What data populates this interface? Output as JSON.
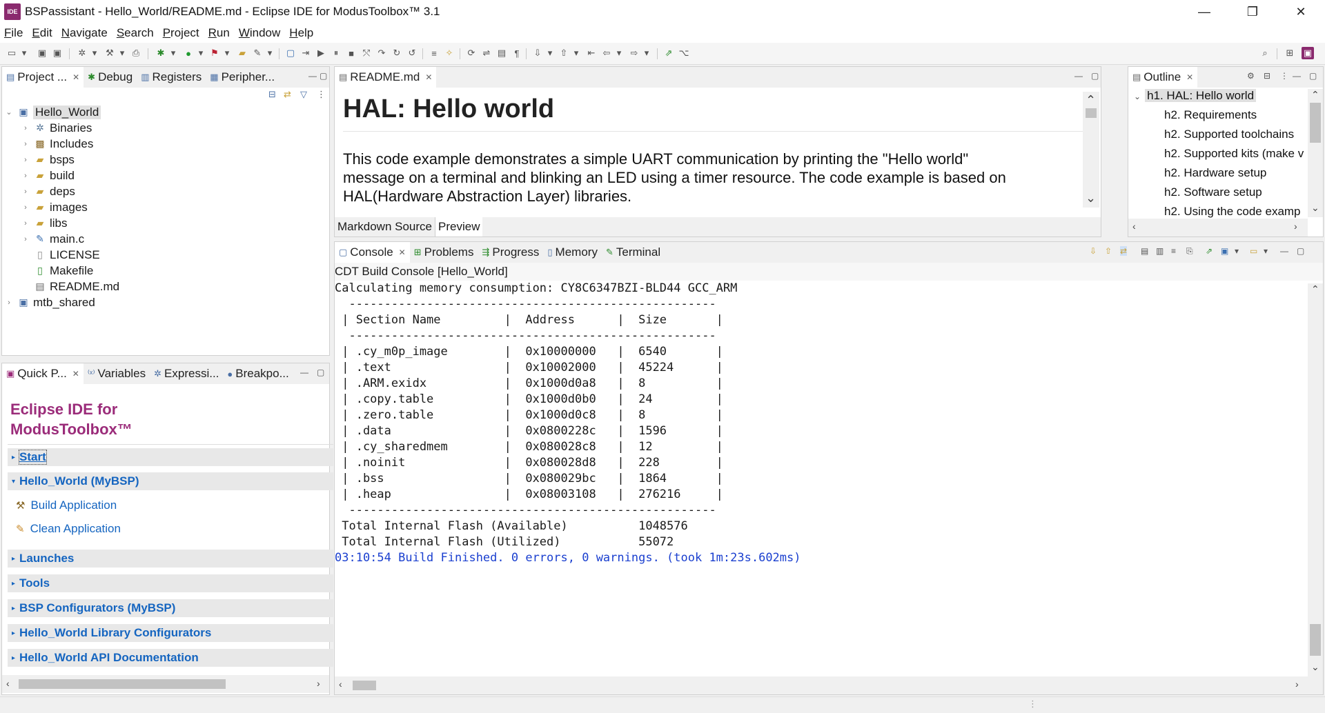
{
  "window": {
    "title": "BSPassistant - Hello_World/README.md - Eclipse IDE for ModusToolbox™ 3.1",
    "app_icon_text": "IDE",
    "controls": {
      "minimize": "—",
      "restore": "❐",
      "close": "✕"
    }
  },
  "menu": [
    "File",
    "Edit",
    "Navigate",
    "Search",
    "Project",
    "Run",
    "Window",
    "Help"
  ],
  "project_panel": {
    "tabs": [
      {
        "label": "Project ...",
        "icon": "project-explorer-icon",
        "closable": true
      },
      {
        "label": "Debug",
        "icon": "debug-icon"
      },
      {
        "label": "Registers",
        "icon": "registers-icon"
      },
      {
        "label": "Peripher...",
        "icon": "peripherals-icon"
      }
    ],
    "tree": [
      {
        "label": "Hello_World",
        "level": 0,
        "expanded": true,
        "icon": "project-icon",
        "selected": true
      },
      {
        "label": "Binaries",
        "level": 1,
        "icon": "binaries-icon",
        "expandable": true
      },
      {
        "label": "Includes",
        "level": 1,
        "icon": "includes-icon",
        "expandable": true
      },
      {
        "label": "bsps",
        "level": 1,
        "icon": "folder-icon",
        "expandable": true
      },
      {
        "label": "build",
        "level": 1,
        "icon": "folder-icon",
        "expandable": true
      },
      {
        "label": "deps",
        "level": 1,
        "icon": "folder-icon",
        "expandable": true
      },
      {
        "label": "images",
        "level": 1,
        "icon": "folder-icon",
        "expandable": true
      },
      {
        "label": "libs",
        "level": 1,
        "icon": "folder-icon",
        "expandable": true
      },
      {
        "label": "main.c",
        "level": 1,
        "icon": "c-file-icon",
        "expandable": true
      },
      {
        "label": "LICENSE",
        "level": 1,
        "icon": "file-icon",
        "expandable": false
      },
      {
        "label": "Makefile",
        "level": 1,
        "icon": "makefile-icon",
        "expandable": false
      },
      {
        "label": "README.md",
        "level": 1,
        "icon": "markdown-file-icon",
        "expandable": false
      },
      {
        "label": "mtb_shared",
        "level": 0,
        "icon": "project-icon",
        "expandable": true
      }
    ]
  },
  "quick_panel": {
    "tabs": [
      {
        "label": "Quick P...",
        "icon": "quick-panel-icon"
      },
      {
        "label": "Variables",
        "icon": "variables-icon"
      },
      {
        "label": "Expressi...",
        "icon": "expressions-icon"
      },
      {
        "label": "Breakpo...",
        "icon": "breakpoints-icon"
      }
    ],
    "brand_line1": "Eclipse IDE for",
    "brand_line2": "ModusToolbox™",
    "start": "Start",
    "project_section": "Hello_World (MyBSP)",
    "build_link": "Build Application",
    "clean_link": "Clean Application",
    "sections": [
      "Launches",
      "Tools",
      "BSP Configurators (MyBSP)",
      "Hello_World Library Configurators",
      "Hello_World API Documentation"
    ]
  },
  "editor": {
    "tab": "README.md",
    "heading": "HAL: Hello world",
    "paragraph": [
      "This code example demonstrates a simple UART communication by printing the \"Hello world\"",
      "message on a terminal and blinking an LED using a timer resource. The code example is based on",
      "HAL(Hardware Abstraction Layer) libraries."
    ],
    "bottom_tabs": [
      "Markdown Source",
      "Preview"
    ]
  },
  "outline": {
    "tab": "Outline",
    "items": [
      {
        "label": "h1. HAL: Hello world",
        "level": 0,
        "selected": true
      },
      {
        "label": "h2. Requirements",
        "level": 1
      },
      {
        "label": "h2. Supported toolchains",
        "level": 1
      },
      {
        "label": "h2. Supported kits (make v",
        "level": 1
      },
      {
        "label": "h2. Hardware setup",
        "level": 1
      },
      {
        "label": "h2. Software setup",
        "level": 1
      },
      {
        "label": "h2. Using the code examp",
        "level": 1
      }
    ]
  },
  "console": {
    "tabs": [
      {
        "label": "Console",
        "icon": "console-icon",
        "closable": true
      },
      {
        "label": "Problems",
        "icon": "problems-icon"
      },
      {
        "label": "Progress",
        "icon": "progress-icon"
      },
      {
        "label": "Memory",
        "icon": "memory-icon"
      },
      {
        "label": "Terminal",
        "icon": "terminal-icon"
      }
    ],
    "header": "CDT Build Console [Hello_World]",
    "lines": [
      "Calculating memory consumption: CY8C6347BZI-BLD44 GCC_ARM",
      "",
      "  ----------------------------------------------------",
      " | Section Name         |  Address      |  Size       |",
      "  ----------------------------------------------------",
      " | .cy_m0p_image        |  0x10000000   |  6540       |",
      " | .text                |  0x10002000   |  45224      |",
      " | .ARM.exidx           |  0x1000d0a8   |  8          |",
      " | .copy.table          |  0x1000d0b0   |  24         |",
      " | .zero.table          |  0x1000d0c8   |  8          |",
      " | .data                |  0x0800228c   |  1596       |",
      " | .cy_sharedmem        |  0x080028c8   |  12         |",
      " | .noinit              |  0x080028d8   |  228        |",
      " | .bss                 |  0x080029bc   |  1864       |",
      " | .heap                |  0x08003108   |  276216     |",
      "  ----------------------------------------------------",
      "",
      " Total Internal Flash (Available)          1048576",
      " Total Internal Flash (Utilized)           55072",
      "",
      "",
      "",
      "03:10:54 Build Finished. 0 errors, 0 warnings. (took 1m:23s.602ms)"
    ],
    "finished_color": "#1a3fcf"
  },
  "colors": {
    "brand": "#9b2c7a",
    "link": "#1565c0",
    "selection": "#e0e0e0"
  }
}
